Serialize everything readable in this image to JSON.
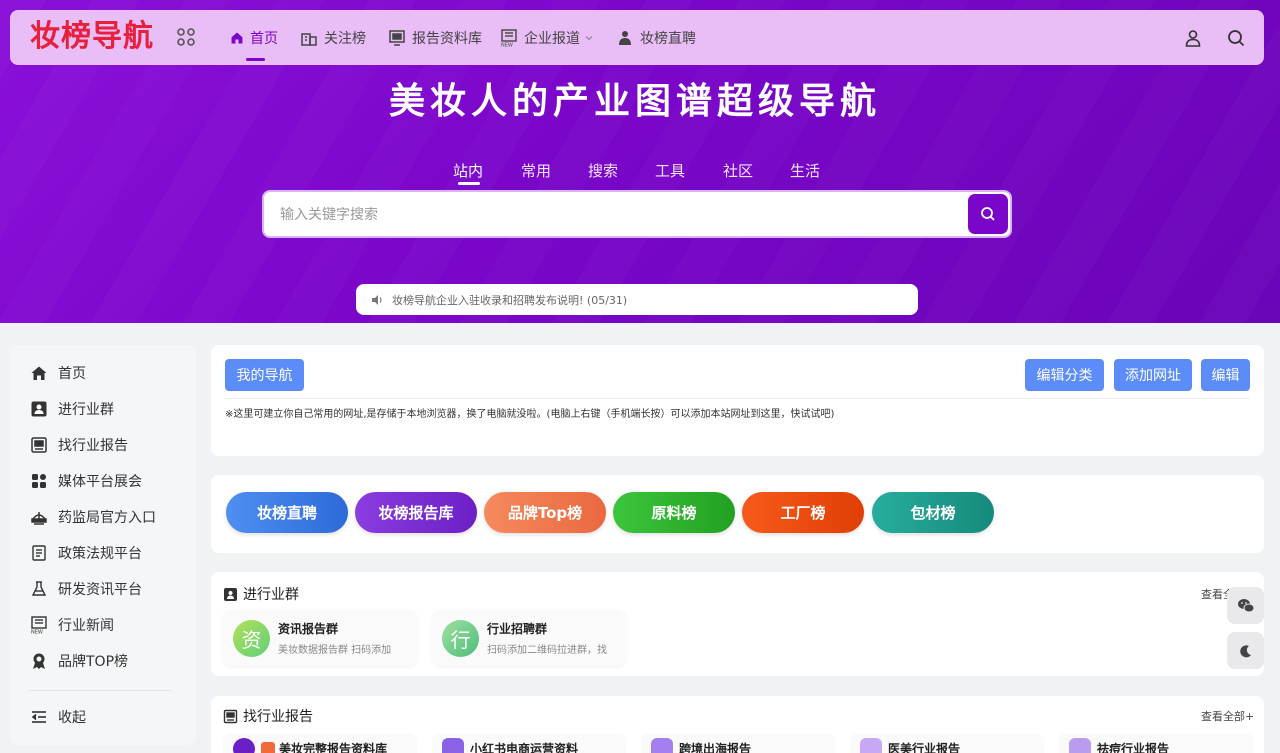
{
  "header": {
    "logo": "妆榜导航",
    "nav": [
      {
        "label": "首页",
        "icon": "home-icon"
      },
      {
        "label": "关注榜",
        "icon": "building-icon"
      },
      {
        "label": "报告资料库",
        "icon": "monitor-icon"
      },
      {
        "label": "企业报道",
        "icon": "news-icon"
      },
      {
        "label": "妆榜直聘",
        "icon": "people-icon"
      }
    ]
  },
  "hero": {
    "title": "美妆人的产业图谱超级导航",
    "tabs": [
      "站内",
      "常用",
      "搜索",
      "工具",
      "社区",
      "生活"
    ],
    "search_placeholder": "输入关键字搜索",
    "notice": "妆榜导航企业入驻收录和招聘发布说明! (05/31)"
  },
  "sidebar": {
    "items": [
      {
        "label": "首页",
        "icon": "home-icon"
      },
      {
        "label": "进行业群",
        "icon": "contact-card-icon"
      },
      {
        "label": "找行业报告",
        "icon": "report-icon"
      },
      {
        "label": "媒体平台展会",
        "icon": "grid-icon"
      },
      {
        "label": "药监局官方入口",
        "icon": "scale-icon"
      },
      {
        "label": "政策法规平台",
        "icon": "document-icon"
      },
      {
        "label": "研发资讯平台",
        "icon": "flask-icon"
      },
      {
        "label": "行业新闻",
        "icon": "news-icon"
      },
      {
        "label": "品牌TOP榜",
        "icon": "badge-icon"
      }
    ],
    "collapse": "收起"
  },
  "mynav": {
    "title": "我的导航",
    "edit_category": "编辑分类",
    "add_url": "添加网址",
    "edit": "编辑",
    "hint": "※这里可建立你自己常用的网址,是存储于本地浏览器，换了电脑就没啦。(电脑上右键（手机端长按）可以添加本站网址到这里，快试试吧)"
  },
  "quick_links": [
    {
      "label": "妆榜直聘",
      "color": "#3d7ee8"
    },
    {
      "label": "妆榜报告库",
      "color": "#7b2fd0"
    },
    {
      "label": "品牌Top榜",
      "color": "#f0744a"
    },
    {
      "label": "原料榜",
      "color": "#2ab22a"
    },
    {
      "label": "工厂榜",
      "color": "#ee4a0c"
    },
    {
      "label": "包材榜",
      "color": "#1e9e8e"
    }
  ],
  "groups": {
    "title": "进行业群",
    "more": "查看全",
    "items": [
      {
        "avatar": "资",
        "title": "资讯报告群",
        "desc": "美妆数据报告群 扫码添加"
      },
      {
        "avatar": "行",
        "title": "行业招聘群",
        "desc": "扫码添加二维码拉进群，找"
      }
    ]
  },
  "reports": {
    "title": "找行业报告",
    "more": "查看全部+",
    "items": [
      {
        "title": "美妆完整报告资料库"
      },
      {
        "title": "小红书电商运营资料"
      },
      {
        "title": "跨境出海报告"
      },
      {
        "title": "医美行业报告"
      },
      {
        "title": "祛痘行业报告"
      }
    ]
  }
}
